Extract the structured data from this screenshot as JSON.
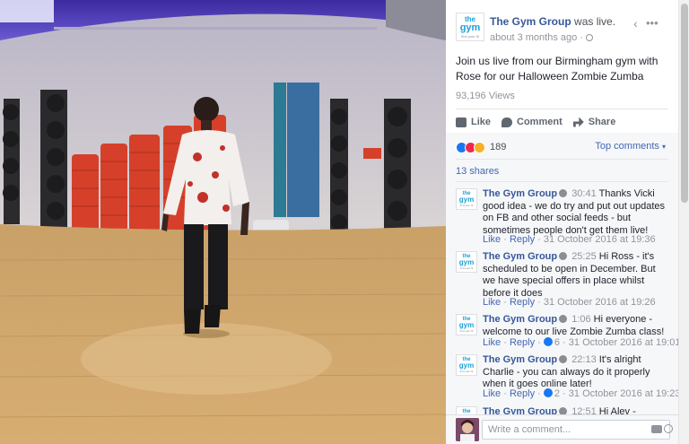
{
  "post": {
    "page_name": "The Gym Group",
    "status": "was live.",
    "time": "about 3 months ago ·",
    "text": "Join us live from our Birmingham gym with Rose for our Halloween Zombie Zumba",
    "views": "93,196 Views",
    "icons": [
      "gym-logo",
      "globe-icon",
      "back-chevron-icon",
      "more-dots-icon"
    ]
  },
  "logo": {
    "line1": "the",
    "line2": "gym",
    "line3": "find your fit"
  },
  "actions": {
    "like": "Like",
    "comment": "Comment",
    "share": "Share"
  },
  "reactions": {
    "count": "189",
    "sort": "Top comments",
    "caret": "▾",
    "icons": [
      "like-reaction",
      "love-reaction",
      "haha-reaction"
    ]
  },
  "shares": "13 shares",
  "comments": [
    {
      "author": "The Gym Group",
      "timestamp": "30:41",
      "text": "Thanks Vicki good idea - we do try and put out updates on FB and other social feeds - but sometimes people don't get them live!",
      "like": "Like",
      "reply": "Reply",
      "date": "31 October 2016 at 19:36"
    },
    {
      "author": "The Gym Group",
      "timestamp": "25:25",
      "text": "Hi Ross - it's scheduled to be open in December. But we have special offers in place whilst before it does",
      "like": "Like",
      "reply": "Reply",
      "date": "31 October 2016 at 19:26"
    },
    {
      "author": "The Gym Group",
      "timestamp": "1:06",
      "text": "Hi everyone - welcome to our live Zombie Zumba class!",
      "like": "Like",
      "reply": "Reply",
      "reactions": "6",
      "date": "31 October 2016 at 19:01"
    },
    {
      "author": "The Gym Group",
      "timestamp": "22:13",
      "text": "It's alright Charlie - you can always do it properly when it goes online later!",
      "like": "Like",
      "reply": "Reply",
      "reactions": "2",
      "date": "31 October 2016 at 19:23"
    },
    {
      "author": "The Gym Group",
      "timestamp": "12:51",
      "text": "Hi Alev - Reading",
      "like": "",
      "reply": "",
      "date": ""
    }
  ],
  "composer": {
    "placeholder": "Write a comment...",
    "icons": [
      "camera-icon",
      "emoji-icon"
    ]
  },
  "colors": {
    "link": "#365899",
    "accent": "#4267b2",
    "muted": "#90949c",
    "panel_bg": "#f6f7f9"
  }
}
